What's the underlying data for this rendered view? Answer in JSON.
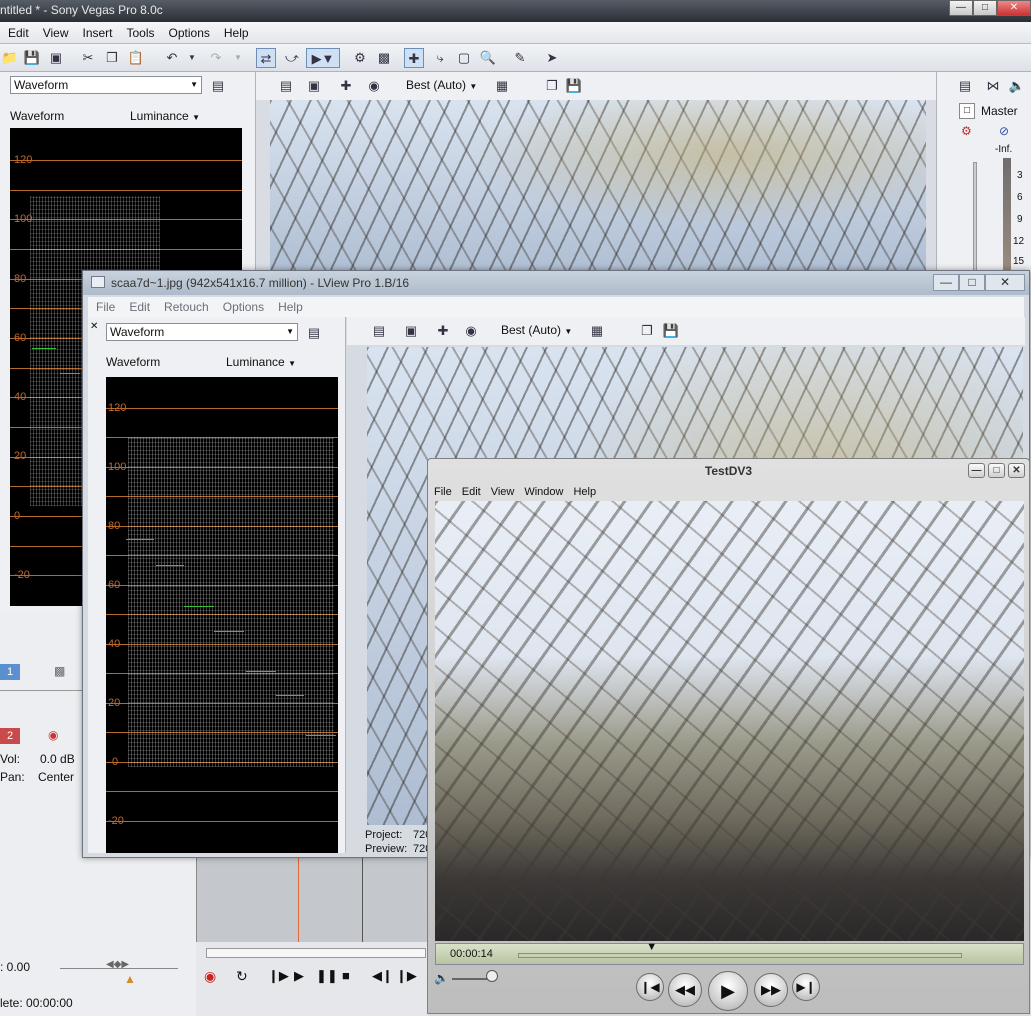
{
  "vegas": {
    "title": "ntitled * - Sony Vegas Pro 8.0c",
    "menu": [
      "Edit",
      "View",
      "Insert",
      "Tools",
      "Options",
      "Help"
    ],
    "left_panel": {
      "scope_select": "Waveform",
      "mode_label": "Waveform",
      "channel_select": "Luminance",
      "y_labels": [
        "120",
        "100",
        "80",
        "60",
        "40",
        "20",
        "0",
        "-20"
      ]
    },
    "preview": {
      "quality_select": "Best (Auto)"
    },
    "mixer": {
      "master_label": "Master",
      "meter_labels": [
        "-Inf.",
        "3",
        "6",
        "9",
        "12",
        "15"
      ]
    },
    "track": {
      "track1_number": "1",
      "track2_number": "2",
      "vol_label": "Vol:",
      "vol_value": "0.0 dB",
      "pan_label": "Pan:",
      "pan_value": "Center"
    },
    "bottom": {
      "rate_value": ": 0.00",
      "complete_label": "lete: 00:00:00"
    }
  },
  "lview": {
    "title": "scaa7d~1.jpg (942x541x16.7 million) - LView Pro 1.B/16",
    "menu": [
      "File",
      "Edit",
      "Retouch",
      "Options",
      "Help"
    ],
    "scope_select": "Waveform",
    "mode_label": "Waveform",
    "channel_select": "Luminance",
    "quality_select": "Best (Auto)",
    "y_labels": [
      "120",
      "100",
      "80",
      "60",
      "40",
      "20",
      "0",
      "-20"
    ],
    "project_label": "Project:",
    "project_value": "720",
    "preview_label": "Preview:",
    "preview_value": "720"
  },
  "qt": {
    "title": "TestDV3",
    "menu": [
      "File",
      "Edit",
      "View",
      "Window",
      "Help"
    ],
    "timecode": "00:00:14",
    "playhead_fraction": 0.3
  },
  "icons": {
    "minimize": "minimize-icon",
    "maximize": "maximize-icon",
    "close": "close-icon"
  },
  "colors": {
    "scope_grid": "#b36a2a",
    "scope_label": "#c06a30",
    "trace_marker": "#3bbf3b"
  }
}
